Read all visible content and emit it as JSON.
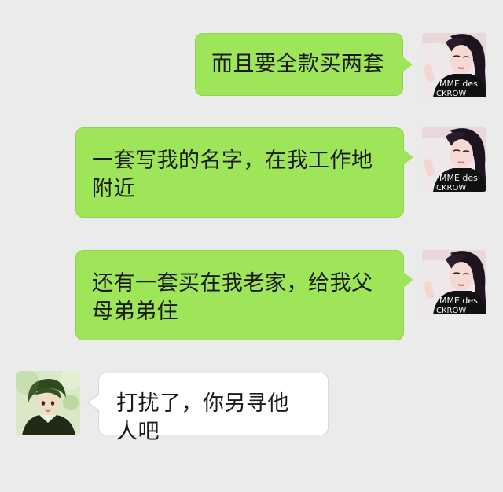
{
  "conversation": {
    "messages": [
      {
        "side": "right",
        "sender": "self",
        "avatar_icon": "girl-avatar-icon",
        "text": "而且要全款买两套"
      },
      {
        "side": "right",
        "sender": "self",
        "avatar_icon": "girl-avatar-icon",
        "text": "一套写我的名字，在我工作地附近"
      },
      {
        "side": "right",
        "sender": "self",
        "avatar_icon": "girl-avatar-icon",
        "text": "还有一套买在我老家，给我父母弟弟住"
      },
      {
        "side": "left",
        "sender": "other",
        "avatar_icon": "boy-avatar-icon",
        "text": "打扰了，你另寻他人吧"
      }
    ],
    "avatar_shirt_text": "MME des CKROW"
  },
  "colors": {
    "background": "#ebebeb",
    "sent_bubble": "#9ee55a",
    "received_bubble": "#ffffff",
    "text": "#1b1b1b"
  }
}
